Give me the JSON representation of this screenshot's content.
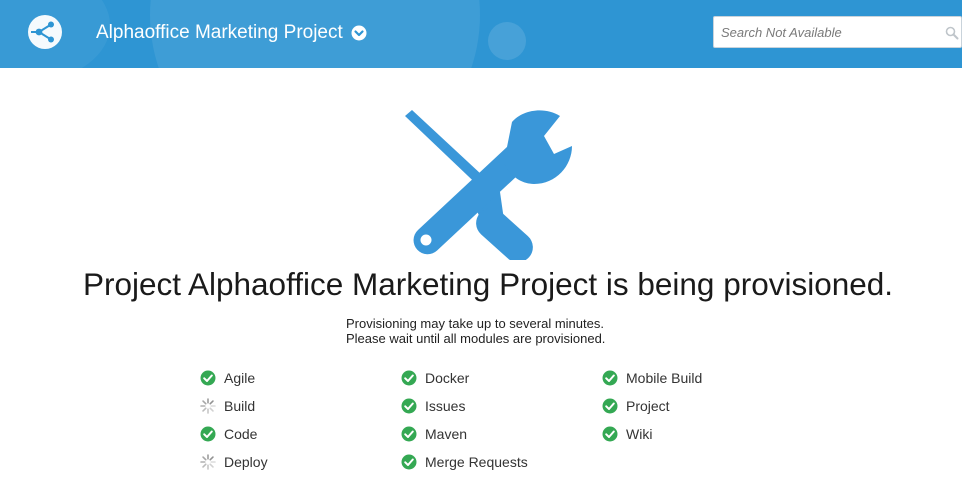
{
  "header": {
    "project_title": "Alphaoffice Marketing Project",
    "background_color": "#2e95d3",
    "logo_icon": "share-nodes-logo-icon",
    "project_menu_icon": "chevron-down-circle-icon"
  },
  "search": {
    "placeholder": "Search Not Available",
    "icon": "search-icon"
  },
  "illustration": {
    "icon": "wrench-screwdriver-icon",
    "color": "#3a97d9"
  },
  "main": {
    "headline": "Project Alphaoffice Marketing Project is being provisioned.",
    "subtext_line1": "Provisioning may take up to several minutes.",
    "subtext_line2": "Please wait until all modules are provisioned."
  },
  "status_colors": {
    "done": "#34a853",
    "pending": "#8a8a8a"
  },
  "modules": [
    {
      "label": "Agile",
      "status": "done"
    },
    {
      "label": "Build",
      "status": "pending"
    },
    {
      "label": "Code",
      "status": "done"
    },
    {
      "label": "Deploy",
      "status": "pending"
    },
    {
      "label": "Docker",
      "status": "done"
    },
    {
      "label": "Issues",
      "status": "done"
    },
    {
      "label": "Maven",
      "status": "done"
    },
    {
      "label": "Merge Requests",
      "status": "done"
    },
    {
      "label": "Mobile Build",
      "status": "done"
    },
    {
      "label": "Project",
      "status": "done"
    },
    {
      "label": "Wiki",
      "status": "done"
    }
  ]
}
